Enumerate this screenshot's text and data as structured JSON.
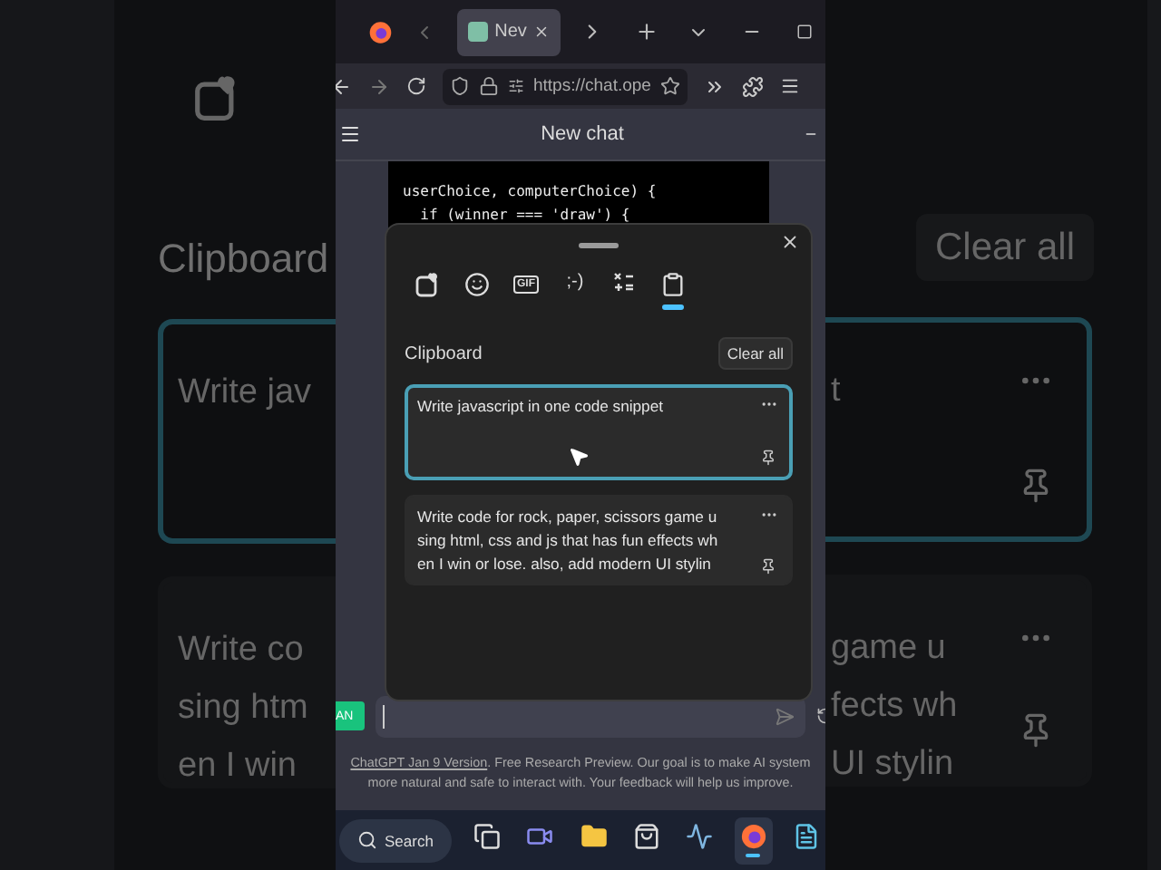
{
  "backdrop_left": {
    "title": "Clipboard",
    "items": [
      {
        "lines": [
          "Write jav"
        ],
        "selected": true
      },
      {
        "lines": [
          "Write co",
          "sing htm",
          "en I win"
        ],
        "selected": false
      }
    ]
  },
  "backdrop_right": {
    "button": "Clear all",
    "items": [
      {
        "lines": [
          "t"
        ],
        "selected": true
      },
      {
        "lines": [
          "game u",
          "fects wh",
          "UI stylin"
        ],
        "selected": false
      }
    ]
  },
  "browser": {
    "tabs": [
      {
        "title": "Nev",
        "selected": true
      }
    ],
    "url": "https://chat.ope"
  },
  "chat": {
    "title": "New chat",
    "code_lines": [
      "userChoice, computerChoice) {",
      "  if (winner === 'draw') {"
    ],
    "avatar": "AN",
    "footer_lines": [
      {
        "link": "ChatGPT Jan 9 Version",
        "text": ". Free Research Preview. Our goal is to make AI system"
      },
      {
        "text": "more natural and safe to interact with. Your feedback will help us improve."
      }
    ]
  },
  "clipboard_panel": {
    "categories": [
      {
        "kind": "favorites",
        "selected": false
      },
      {
        "kind": "emoji",
        "selected": false
      },
      {
        "kind": "gif",
        "label": "GIF",
        "selected": false
      },
      {
        "kind": "kaomoji",
        "label": ";-)",
        "selected": false
      },
      {
        "kind": "symbols",
        "selected": false
      },
      {
        "kind": "clipboard",
        "selected": true
      }
    ],
    "title": "Clipboard",
    "clear_button": "Clear all",
    "items": [
      {
        "lines": [
          "Write javascript in one code snippet"
        ],
        "selected": true
      },
      {
        "lines": [
          "Write code for rock, paper, scissors game u",
          "sing html, css and js that has fun effects wh",
          "en I win or lose. also, add modern UI stylin"
        ],
        "selected": false
      }
    ]
  },
  "taskbar": {
    "search": "Search",
    "apps": [
      {
        "kind": "task-view",
        "selected": false
      },
      {
        "kind": "meet",
        "selected": false
      },
      {
        "kind": "folder",
        "selected": false
      },
      {
        "kind": "store",
        "selected": false
      },
      {
        "kind": "monitor",
        "selected": false
      },
      {
        "kind": "firefox",
        "selected": true
      },
      {
        "kind": "notepad",
        "selected": false
      }
    ]
  }
}
